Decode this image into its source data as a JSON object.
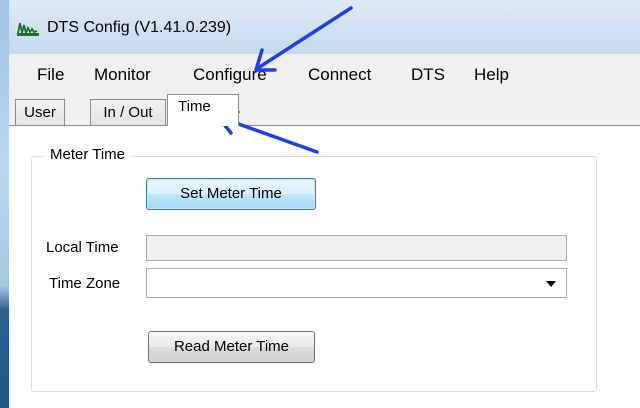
{
  "window": {
    "title": "DTS Config (V1.41.0.239)",
    "app_icon": "waveform-icon"
  },
  "menu": [
    {
      "label": "File"
    },
    {
      "label": "Monitor"
    },
    {
      "label": "Configure"
    },
    {
      "label": "Connect"
    },
    {
      "label": "DTS"
    },
    {
      "label": "Help"
    }
  ],
  "tabs": [
    {
      "label": "User",
      "selected": false
    },
    {
      "label": "In / Out",
      "selected": false
    },
    {
      "label": "Time",
      "selected": true
    }
  ],
  "meter_time": {
    "group_label": "Meter Time",
    "set_button": "Set Meter Time",
    "local_time_label": "Local Time",
    "local_time_value": "",
    "time_zone_label": "Time Zone",
    "time_zone_value": "",
    "read_button": "Read Meter Time"
  },
  "annotations": {
    "arrow_color": "#1f3ee8",
    "arrows": [
      "arrow-to-configure-menu",
      "arrow-to-time-tab"
    ]
  }
}
